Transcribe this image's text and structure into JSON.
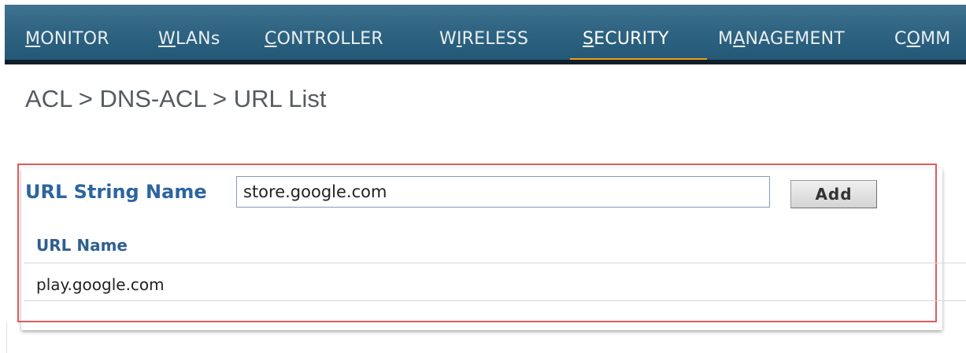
{
  "nav": {
    "items": [
      {
        "label": "MONITOR"
      },
      {
        "label": "WLANs"
      },
      {
        "label": "CONTROLLER"
      },
      {
        "label": "WIRELESS"
      },
      {
        "label": "SECURITY",
        "active": true
      },
      {
        "label": "MANAGEMENT"
      },
      {
        "label": "COMM"
      }
    ],
    "active_color": "#f39c12",
    "bar_color": "#2f6582"
  },
  "breadcrumb": "ACL > DNS-ACL > URL List",
  "form": {
    "url_string_label": "URL String Name",
    "url_string_value": "store.google.com",
    "add_label": "Add"
  },
  "table": {
    "header": "URL Name",
    "rows": [
      {
        "url_name": "play.google.com"
      }
    ]
  },
  "colors": {
    "highlight_border": "#e35a5a",
    "label_blue": "#2c64a0"
  }
}
